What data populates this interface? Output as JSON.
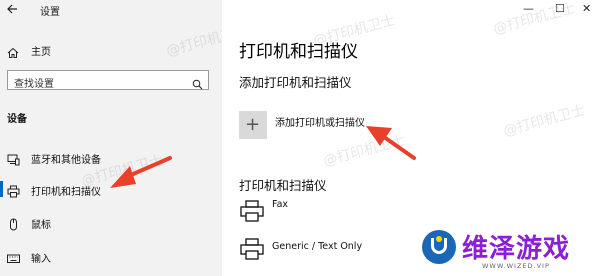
{
  "window": {
    "title": "设置",
    "back_icon": "back-arrow-icon",
    "controls": [
      "—",
      "☐",
      "✕"
    ]
  },
  "sidebar": {
    "home_label": "主页",
    "search_placeholder": "查找设置",
    "section_title": "设备",
    "items": [
      {
        "label": "蓝牙和其他设备",
        "icon": "bluetooth-devices-icon"
      },
      {
        "label": "打印机和扫描仪",
        "icon": "printer-icon",
        "active": true
      },
      {
        "label": "鼠标",
        "icon": "mouse-icon"
      },
      {
        "label": "输入",
        "icon": "keyboard-icon"
      }
    ]
  },
  "main": {
    "page_title": "打印机和扫描仪",
    "add_section_title": "添加打印机和扫描仪",
    "add_button_label": "添加打印机或扫描仪",
    "list_title": "打印机和扫描仪",
    "printers": [
      {
        "name": "Fax"
      },
      {
        "name": "Generic / Text Only"
      }
    ]
  },
  "watermark": "@打印机卫士",
  "brand": {
    "name": "维泽游戏",
    "url": "WWW.WIZED.VIP"
  },
  "colors": {
    "sidebar_bg": "#f2f2f2",
    "accent": "#0067c0",
    "arrow": "#e8402a",
    "brand_purple": "#8b1fd6",
    "brand_blue": "#1a66b8"
  }
}
